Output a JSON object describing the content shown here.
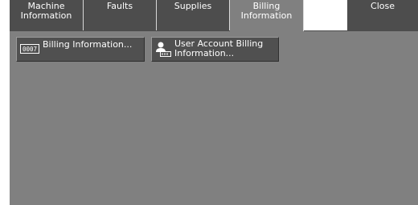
{
  "tabs": [
    {
      "id": "machine-information",
      "label": "Machine\nInformation"
    },
    {
      "id": "faults",
      "label": "Faults"
    },
    {
      "id": "supplies",
      "label": "Supplies"
    },
    {
      "id": "billing-information",
      "label": "Billing\nInformation"
    },
    {
      "id": "blank",
      "label": ""
    },
    {
      "id": "close",
      "label": "Close"
    }
  ],
  "active_tab": "billing-information",
  "buttons": {
    "billing_information": {
      "label": "Billing Information...",
      "icon": "counter-icon",
      "icon_text": "0007"
    },
    "user_account_billing": {
      "label": "User Account Billing\nInformation...",
      "icon": "user-counter-icon"
    }
  },
  "colors": {
    "tab_bar": "#4d4d4d",
    "screen": "#808080",
    "button": "#505050",
    "text": "#ffffff"
  }
}
